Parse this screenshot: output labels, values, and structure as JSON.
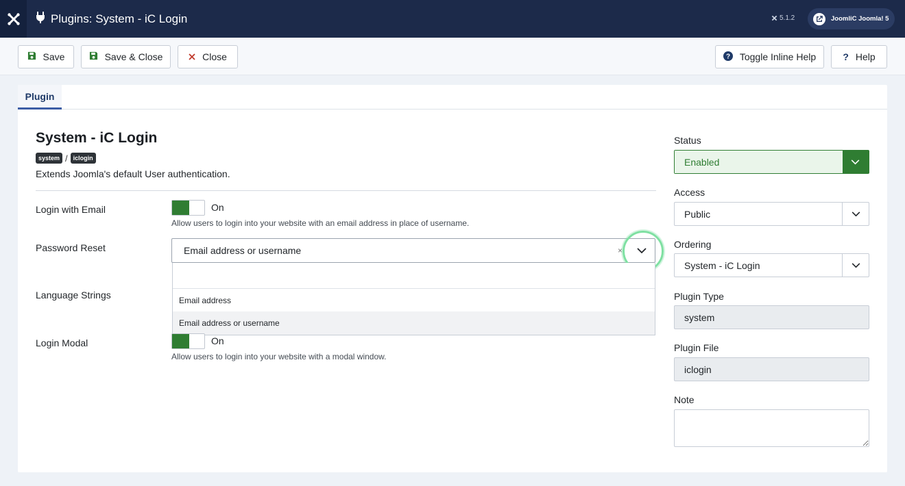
{
  "header": {
    "title": "Plugins: System - iC Login",
    "version": "5.1.2",
    "site_button_label": "JoomliC Joomla! 5"
  },
  "toolbar": {
    "save": "Save",
    "save_close": "Save & Close",
    "close": "Close",
    "toggle_help": "Toggle Inline Help",
    "help": "Help"
  },
  "tabs": [
    {
      "label": "Plugin"
    }
  ],
  "plugin": {
    "name": "System - iC Login",
    "folder_badge": "system",
    "element_badge": "iclogin",
    "separator": "/",
    "description": "Extends Joomla's default User authentication."
  },
  "fields": {
    "login_with_email": {
      "label": "Login with Email",
      "state": "On",
      "hint": "Allow users to login into your website with an email address in place of username."
    },
    "password_reset": {
      "label": "Password Reset",
      "value": "Email address or username",
      "clear": "×",
      "options": [
        "Email address",
        "Email address or username"
      ]
    },
    "language_strings": {
      "label": "Language Strings"
    },
    "login_modal": {
      "label": "Login Modal",
      "state": "On",
      "hint": "Allow users to login into your website with a modal window."
    }
  },
  "sidebar": {
    "status": {
      "label": "Status",
      "value": "Enabled"
    },
    "access": {
      "label": "Access",
      "value": "Public"
    },
    "ordering": {
      "label": "Ordering",
      "value": "System - iC Login"
    },
    "plugin_type": {
      "label": "Plugin Type",
      "value": "system"
    },
    "plugin_file": {
      "label": "Plugin File",
      "value": "iclogin"
    },
    "note": {
      "label": "Note",
      "value": ""
    }
  },
  "colors": {
    "header_bg": "#1c2a4a",
    "enabled_green": "#2f7d32",
    "focus_ring": "#7fe0a2",
    "tab_accent": "#3c5da5"
  },
  "icons": {
    "joomla_logo": "joomla-logo-icon",
    "plug": "plug-icon",
    "save": "floppy-icon",
    "close": "x-icon",
    "help_toggle": "question-circle-icon",
    "help": "question-icon",
    "external": "external-link-icon",
    "chevron": "chevron-down-icon"
  }
}
